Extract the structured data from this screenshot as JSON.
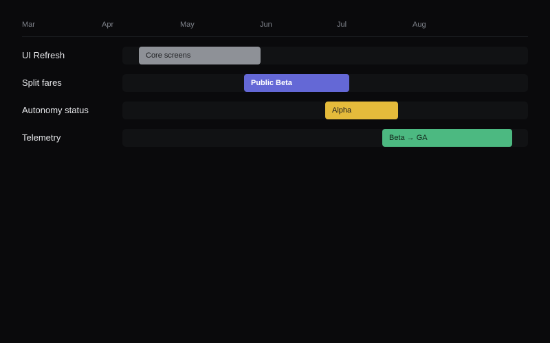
{
  "timeline": {
    "months": [
      "Mar",
      "Apr",
      "May",
      "Jun",
      "Jul",
      "Aug"
    ]
  },
  "rows": [
    {
      "label": "UI Refresh",
      "bar": {
        "label": "Core screens",
        "color": "#8e9197",
        "text_color": "#1a1b1e"
      }
    },
    {
      "label": "Split fares",
      "bar": {
        "label": "Public Beta",
        "color": "#6468d6",
        "text_color": "#ffffff"
      }
    },
    {
      "label": "Autonomy status",
      "bar": {
        "label": "Alpha",
        "color": "#e5bb3b",
        "text_color": "#1a1b1e"
      }
    },
    {
      "label": "Telemetry",
      "bar": {
        "label": "Beta → GA",
        "color": "#4cb981",
        "text_color": "#13241a"
      }
    }
  ],
  "colors": {
    "background": "#0a0a0c",
    "track": "#111214",
    "month_text": "#7f838b",
    "row_text": "#e6e7ea"
  }
}
